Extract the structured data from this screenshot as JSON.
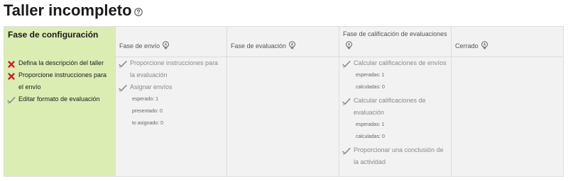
{
  "page": {
    "title": "Taller incompleto",
    "help_icon": "question-circle-icon"
  },
  "phases": [
    {
      "name": "Fase de configuración",
      "active": true,
      "tasks": [
        {
          "status": "fail",
          "icon": "cross-icon",
          "label": "Defina la descripción del taller"
        },
        {
          "status": "fail",
          "icon": "cross-icon",
          "label": "Proporcione instrucciones para el envío"
        },
        {
          "status": "info",
          "icon": "check-icon",
          "label": "Editar formato de evaluación"
        }
      ]
    },
    {
      "name": "Fase de envío",
      "active": false,
      "tasks": [
        {
          "status": "todo",
          "icon": "check-icon",
          "label": "Proporcione instrucciones para la evaluación"
        },
        {
          "status": "todo",
          "icon": "check-icon",
          "label": "Asignar envíos",
          "details": [
            {
              "label": "esperado:",
              "value": "1"
            },
            {
              "label": "presentado:",
              "value": "0"
            },
            {
              "label": "to asignado:",
              "value": "0"
            }
          ]
        }
      ]
    },
    {
      "name": "Fase de evaluación",
      "active": false,
      "tasks": []
    },
    {
      "name": "Fase de calificación de evaluaciones",
      "active": false,
      "tasks": [
        {
          "status": "todo",
          "icon": "check-icon",
          "label": "Calcular calificaciones de envíos",
          "details": [
            {
              "label": "esperadas:",
              "value": "1"
            },
            {
              "label": "calculadas:",
              "value": "0"
            }
          ]
        },
        {
          "status": "todo",
          "icon": "check-icon",
          "label": "Calcular calificaciones de evaluación",
          "details": [
            {
              "label": "esperadas:",
              "value": "1"
            },
            {
              "label": "calculadas:",
              "value": "0"
            }
          ]
        },
        {
          "status": "todo",
          "icon": "check-icon",
          "label": "Proporcionar una conclusión de la actividad"
        }
      ]
    },
    {
      "name": "Cerrado",
      "active": false,
      "tasks": []
    }
  ],
  "colors": {
    "active_phase": "#dcedb4",
    "inactive_phase": "#f2f2f2",
    "fail": "#cc2222",
    "check": "#8a8a8a"
  }
}
